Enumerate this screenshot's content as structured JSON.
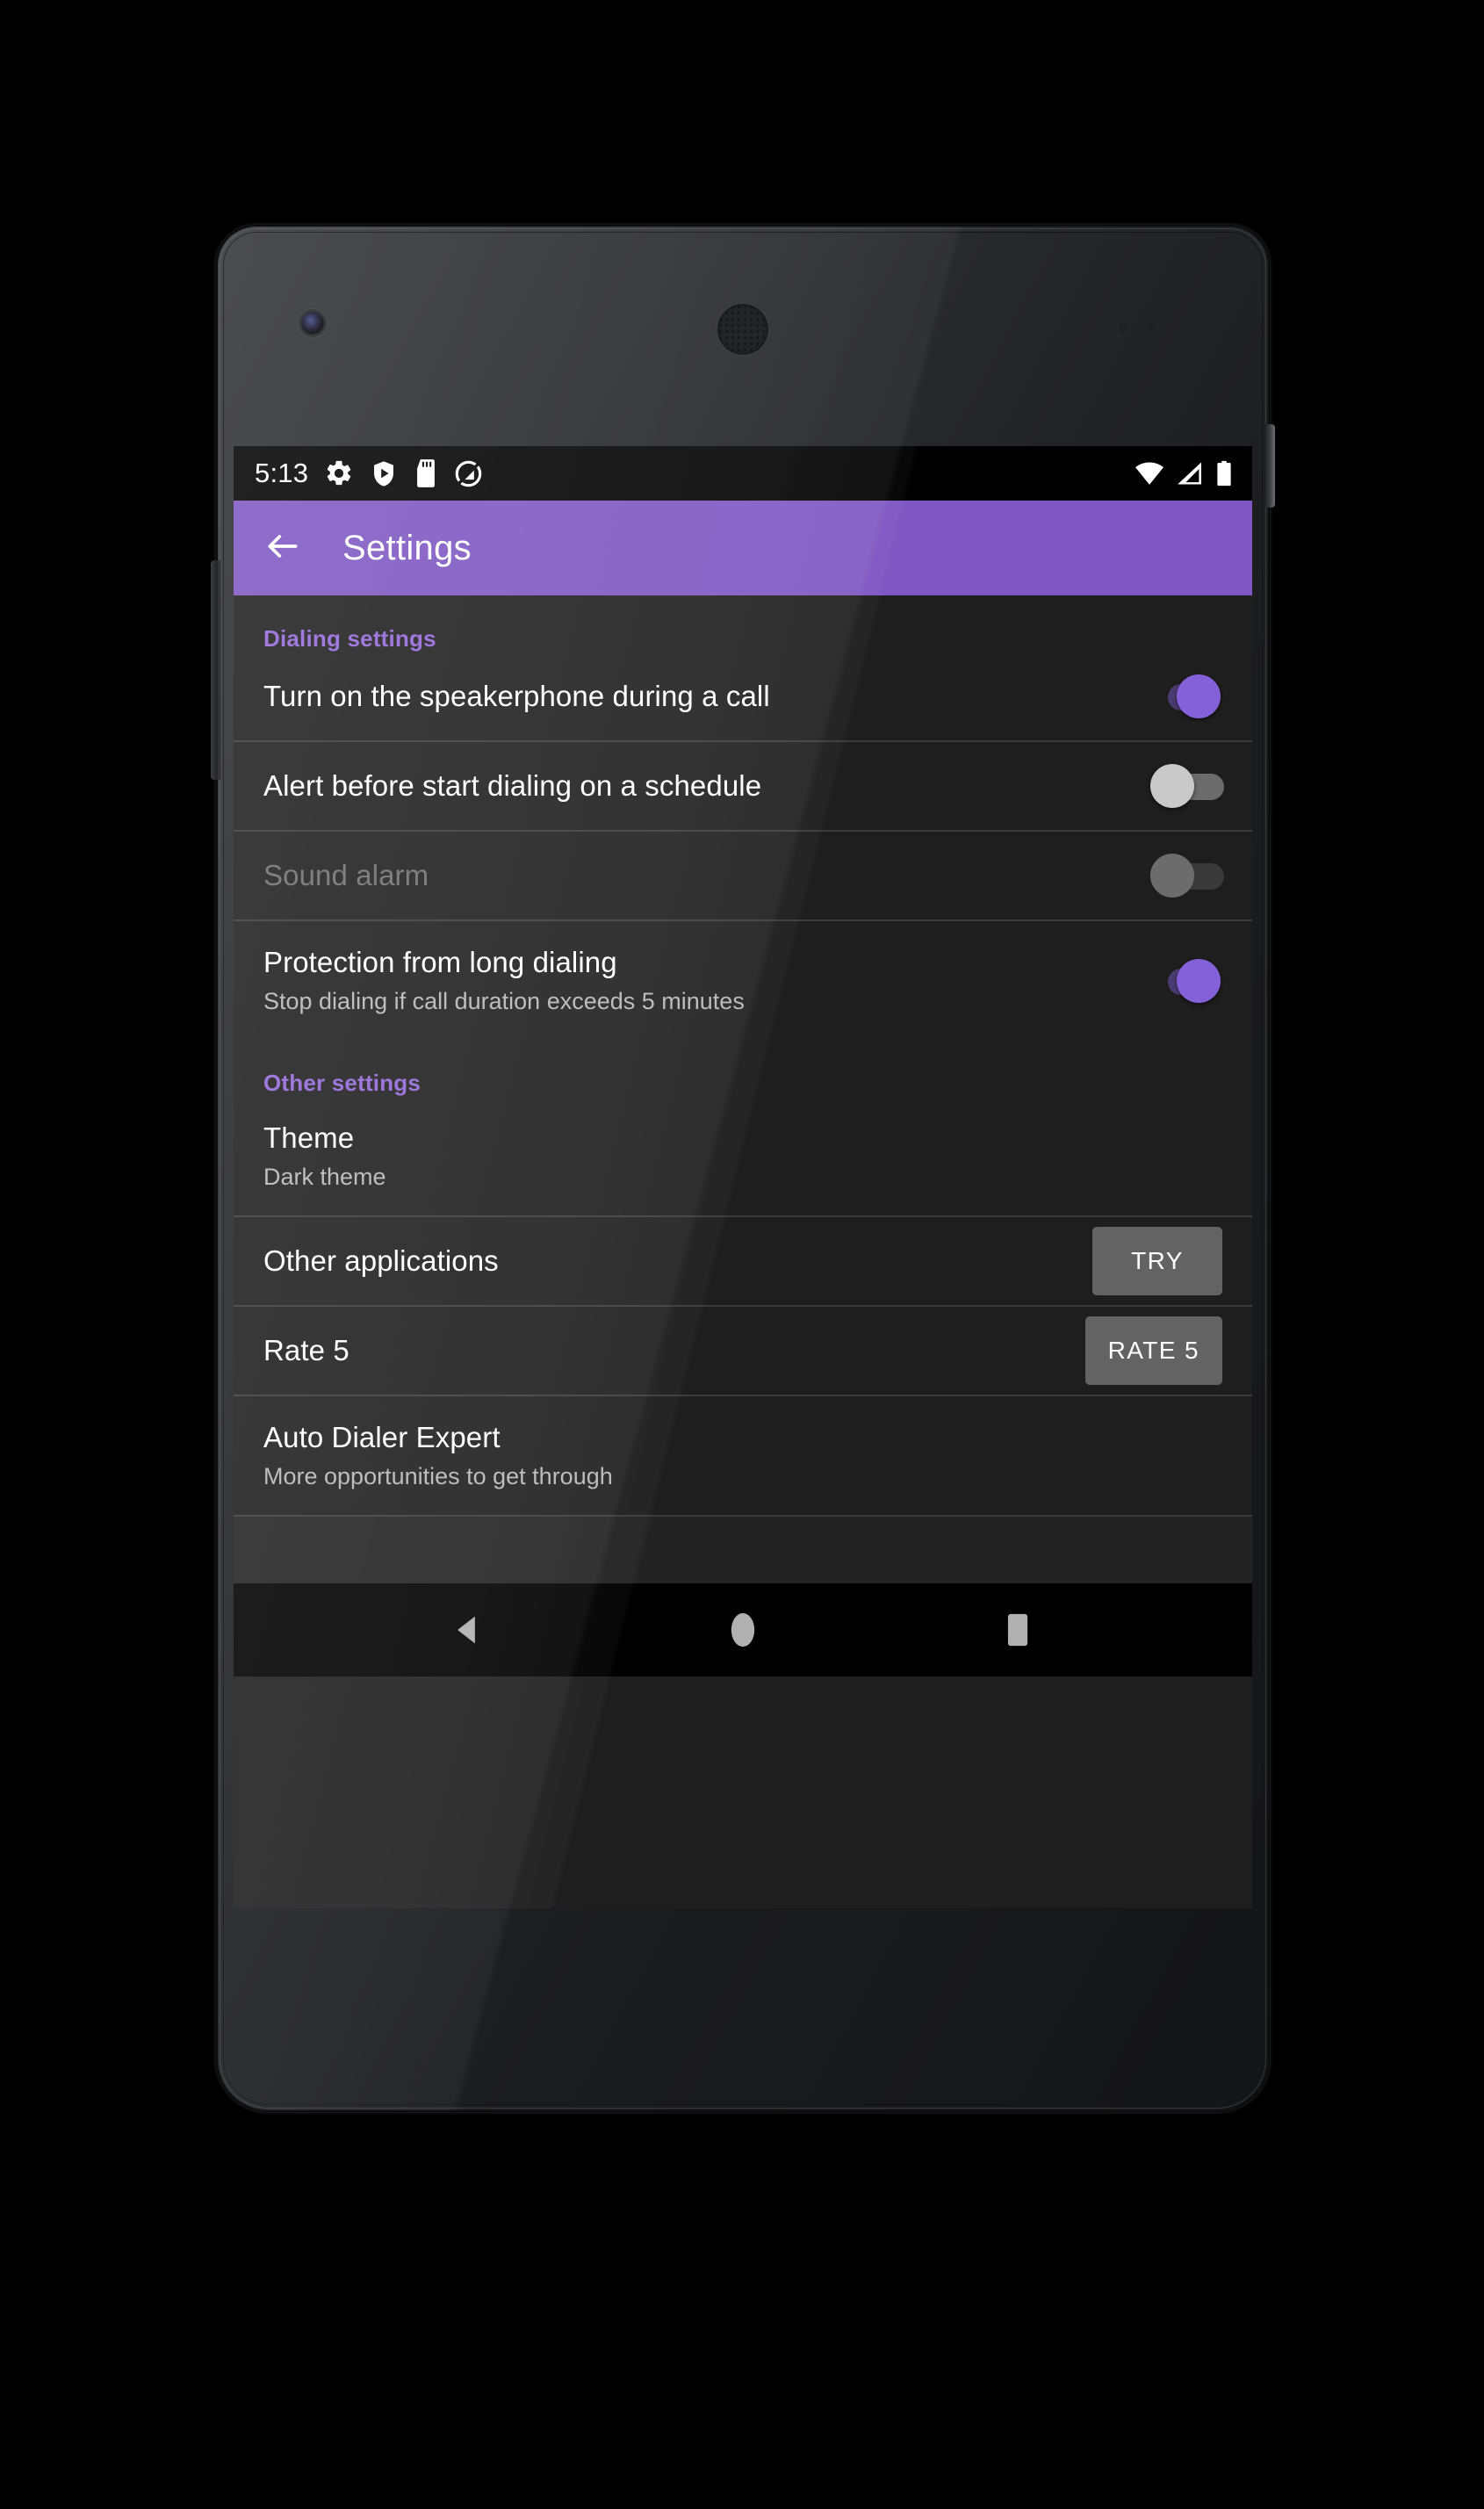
{
  "status_bar": {
    "time": "5:13",
    "left_icons": [
      "gear-icon",
      "play-protect-shield-icon",
      "sd-card-icon",
      "do-not-disturb-icon"
    ],
    "right_icons": [
      "wifi-icon",
      "cell-signal-icon",
      "battery-full-icon"
    ]
  },
  "app_bar": {
    "back_icon": "back-arrow-icon",
    "title": "Settings",
    "accent_color": "#7e57c2"
  },
  "sections": [
    {
      "header": "Dialing settings",
      "rows": [
        {
          "title": "Turn on the speakerphone during a call",
          "subtitle": "",
          "control": "switch",
          "state": "on"
        },
        {
          "title": "Alert before start dialing on a schedule",
          "subtitle": "",
          "control": "switch",
          "state": "off"
        },
        {
          "title": "Sound alarm",
          "subtitle": "",
          "control": "switch",
          "state": "disabled"
        },
        {
          "title": "Protection from long dialing",
          "subtitle": "Stop dialing if call duration exceeds 5 minutes",
          "control": "switch",
          "state": "on"
        }
      ]
    },
    {
      "header": "Other settings",
      "rows": [
        {
          "title": "Theme",
          "subtitle": "Dark theme",
          "control": "none",
          "state": ""
        },
        {
          "title": "Other applications",
          "subtitle": "",
          "control": "button",
          "button_label": "TRY"
        },
        {
          "title": "Rate 5",
          "subtitle": "",
          "control": "button",
          "button_label": "RATE 5"
        },
        {
          "title": "Auto Dialer Expert",
          "subtitle": "More opportunities to get through",
          "control": "none",
          "state": ""
        }
      ]
    }
  ],
  "nav_bar": {
    "back": "nav-back-icon",
    "home": "nav-home-icon",
    "recents": "nav-recents-icon"
  },
  "colors": {
    "accent_purple": "#7e57c2",
    "section_header": "#9367d8",
    "switch_on_thumb": "#8461d8",
    "switch_on_track": "#4a3b72",
    "list_background": "#1e1e1e",
    "button_gray": "#636363"
  }
}
